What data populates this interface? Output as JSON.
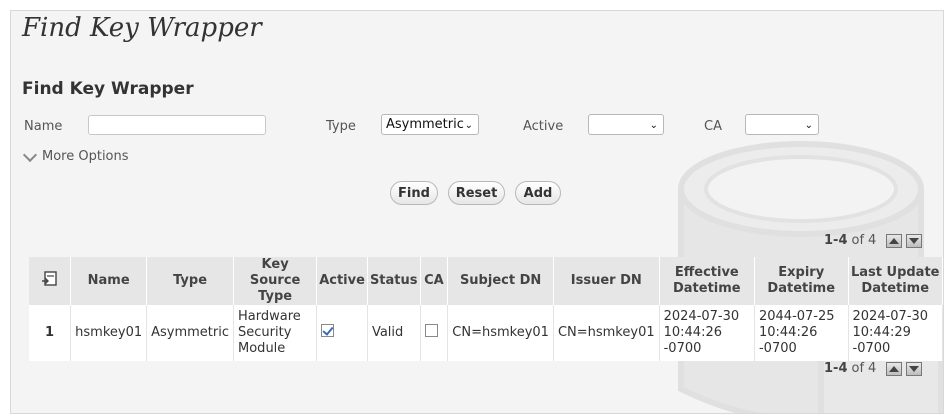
{
  "page_title": "Find Key Wrapper",
  "section_title": "Find Key Wrapper",
  "filters": {
    "name_label": "Name",
    "name_value": "",
    "type_label": "Type",
    "type_value": "Asymmetric",
    "active_label": "Active",
    "active_value": "",
    "ca_label": "CA",
    "ca_value": ""
  },
  "more_options_label": "More Options",
  "buttons": {
    "find": "Find",
    "reset": "Reset",
    "add": "Add"
  },
  "pager": {
    "range": "1-4",
    "of": "of",
    "total": "4"
  },
  "table": {
    "headers": {
      "name": "Name",
      "type": "Type",
      "key_source_type": "Key Source Type",
      "active": "Active",
      "status": "Status",
      "ca": "CA",
      "subject_dn": "Subject DN",
      "issuer_dn": "Issuer DN",
      "effective": "Effective Datetime",
      "expiry": "Expiry Datetime",
      "last_update": "Last Update Datetime"
    },
    "rows": [
      {
        "index": "1",
        "name": "hsmkey01",
        "type": "Asymmetric",
        "key_source_type": "Hardware Security Module",
        "active": true,
        "status": "Valid",
        "ca": false,
        "subject_dn": "CN=hsmkey01",
        "issuer_dn": "CN=hsmkey01",
        "effective": "2024-07-30 10:44:26 -0700",
        "expiry": "2044-07-25 10:44:26 -0700",
        "last_update": "2024-07-30 10:44:29 -0700"
      }
    ]
  },
  "icons": {
    "column_chooser": "column-chooser-icon",
    "chevron": "chevron-down-icon",
    "page_up": "page-up-icon",
    "page_down": "page-down-icon",
    "watermark": "database-lock-icon"
  }
}
